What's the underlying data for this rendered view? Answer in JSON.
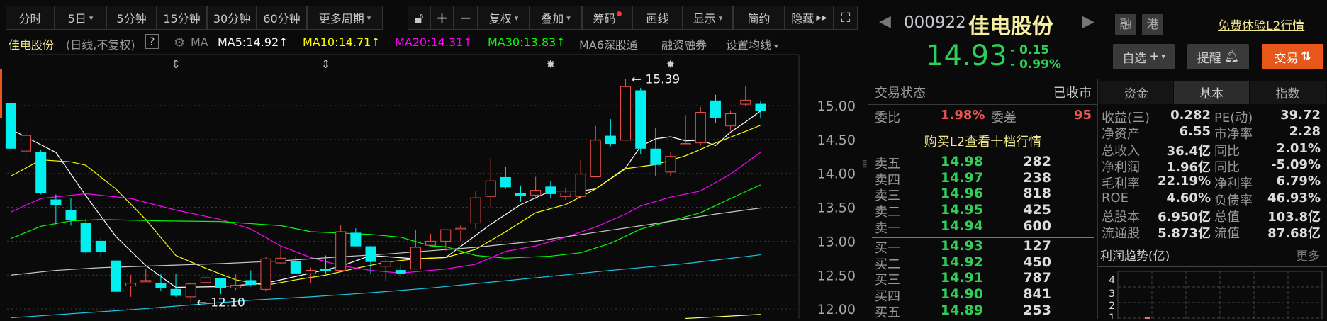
{
  "toolbar": {
    "periods": [
      {
        "label": "分时",
        "dropdown": false
      },
      {
        "label": "5日",
        "dropdown": true
      },
      {
        "label": "5分钟",
        "dropdown": false
      },
      {
        "label": "15分钟",
        "dropdown": false
      },
      {
        "label": "30分钟",
        "dropdown": false
      },
      {
        "label": "60分钟",
        "dropdown": false
      },
      {
        "label": "更多周期",
        "dropdown": true
      }
    ],
    "tools": [
      {
        "label": "复权",
        "dropdown": true
      },
      {
        "label": "叠加",
        "dropdown": true
      },
      {
        "label": "筹码",
        "dropdown": false,
        "badge": true
      },
      {
        "label": "画线",
        "dropdown": false
      },
      {
        "label": "显示",
        "dropdown": true
      },
      {
        "label": "简约",
        "dropdown": false
      },
      {
        "label": "隐藏",
        "dropdown": false
      }
    ],
    "icons": [
      "lock-icon",
      "plus-icon",
      "minus-icon",
      "expand-icon"
    ]
  },
  "legend": {
    "name": "佳电股份",
    "mode": "(日线,不复权)",
    "help": "?",
    "ma": "MA",
    "ma5": "MA5:14.92",
    "ma10": "MA10:14.71",
    "ma20": "MA20:14.31",
    "ma30": "MA30:13.83",
    "ma6": "MA6深股通",
    "margin": "融资融券",
    "settings": "设置均线",
    "arrow": "↑"
  },
  "colors": {
    "up": "#f0524f",
    "down": "#00f0f0",
    "ma5": "#ffffff",
    "ma10": "#ffff00",
    "ma20": "#ff00ff",
    "ma30": "#00ff00",
    "ma60": "#c8c8c8",
    "ma120": "#19c8e8",
    "green": "#2ed158",
    "red": "#f0524f",
    "accent": "#e8571a"
  },
  "chart_data": {
    "type": "candlestick",
    "ylim": [
      11.85,
      15.5
    ],
    "yticks": [
      "15.00",
      "14.50",
      "14.00",
      "13.50",
      "13.00",
      "12.50",
      "12.00"
    ],
    "ytick_values": [
      15,
      14.5,
      14,
      13.5,
      13,
      12.5,
      12
    ],
    "candles_ohlc": [
      [
        15.03,
        15.08,
        14.31,
        14.37
      ],
      [
        14.33,
        14.75,
        14.12,
        14.56
      ],
      [
        14.31,
        14.35,
        13.69,
        13.71
      ],
      [
        13.61,
        13.69,
        13.25,
        13.54
      ],
      [
        13.45,
        13.64,
        13.23,
        13.32
      ],
      [
        13.26,
        13.33,
        12.82,
        12.84
      ],
      [
        13.0,
        13.05,
        12.77,
        12.85
      ],
      [
        12.71,
        12.75,
        12.18,
        12.26
      ],
      [
        12.34,
        12.5,
        12.18,
        12.38
      ],
      [
        12.4,
        12.6,
        12.4,
        12.42
      ],
      [
        12.38,
        12.52,
        12.26,
        12.32
      ],
      [
        12.29,
        12.52,
        12.18,
        12.2
      ],
      [
        12.18,
        12.39,
        12.1,
        12.37
      ],
      [
        12.39,
        12.5,
        12.36,
        12.46
      ],
      [
        12.45,
        12.46,
        12.22,
        12.32
      ],
      [
        12.31,
        12.51,
        12.28,
        12.35
      ],
      [
        12.42,
        12.57,
        12.33,
        12.36
      ],
      [
        12.29,
        12.77,
        12.26,
        12.74
      ],
      [
        12.68,
        12.92,
        12.67,
        12.75
      ],
      [
        12.7,
        12.78,
        12.53,
        12.53
      ],
      [
        12.52,
        12.61,
        12.38,
        12.57
      ],
      [
        12.59,
        12.79,
        12.52,
        12.56
      ],
      [
        12.57,
        13.24,
        12.57,
        13.14
      ],
      [
        13.12,
        13.19,
        12.91,
        12.93
      ],
      [
        12.92,
        12.93,
        12.52,
        12.7
      ],
      [
        12.63,
        12.73,
        12.41,
        12.7
      ],
      [
        12.57,
        12.65,
        12.47,
        12.53
      ],
      [
        12.59,
        13.17,
        12.59,
        12.91
      ],
      [
        12.94,
        13.11,
        12.93,
        13.0
      ],
      [
        13.0,
        13.17,
        12.86,
        13.17
      ],
      [
        13.17,
        13.24,
        13.0,
        13.19
      ],
      [
        13.27,
        13.74,
        13.18,
        13.64
      ],
      [
        13.66,
        14.22,
        13.5,
        13.89
      ],
      [
        13.94,
        14.1,
        13.77,
        13.8
      ],
      [
        13.7,
        13.82,
        13.58,
        13.67
      ],
      [
        13.68,
        13.95,
        13.62,
        13.75
      ],
      [
        13.8,
        13.89,
        13.64,
        13.7
      ],
      [
        13.66,
        13.79,
        13.61,
        13.71
      ],
      [
        13.66,
        14.2,
        13.66,
        13.99
      ],
      [
        13.95,
        14.7,
        13.95,
        14.49
      ],
      [
        14.55,
        14.8,
        14.4,
        14.44
      ],
      [
        14.49,
        15.39,
        14.49,
        15.28
      ],
      [
        15.22,
        15.26,
        14.29,
        14.37
      ],
      [
        14.36,
        14.67,
        13.96,
        14.13
      ],
      [
        14.02,
        14.32,
        13.96,
        14.25
      ],
      [
        14.43,
        14.86,
        14.43,
        14.44
      ],
      [
        14.45,
        14.98,
        14.41,
        14.9
      ],
      [
        15.07,
        15.16,
        14.75,
        14.82
      ],
      [
        14.7,
        14.93,
        14.63,
        14.88
      ],
      [
        15.02,
        15.29,
        15.0,
        15.08
      ],
      [
        15.02,
        15.07,
        14.82,
        14.93
      ]
    ],
    "ma_series": [
      {
        "name": "MA5",
        "color": "#ffffff",
        "points": [
          [
            0,
            14.65
          ],
          [
            3,
            14.31
          ],
          [
            5,
            13.67
          ],
          [
            7,
            13.07
          ],
          [
            9,
            12.64
          ],
          [
            11,
            12.32
          ],
          [
            14,
            12.33
          ],
          [
            17,
            12.38
          ],
          [
            20,
            12.53
          ],
          [
            22,
            12.63
          ],
          [
            24,
            12.79
          ],
          [
            27,
            12.74
          ],
          [
            29,
            12.76
          ],
          [
            32,
            13.25
          ],
          [
            34,
            13.54
          ],
          [
            36,
            13.74
          ],
          [
            38,
            13.74
          ],
          [
            39,
            13.77
          ],
          [
            41,
            14.08
          ],
          [
            42,
            14.4
          ],
          [
            43,
            14.51
          ],
          [
            44,
            14.54
          ],
          [
            45,
            14.48
          ],
          [
            46,
            14.49
          ],
          [
            47,
            14.41
          ],
          [
            48,
            14.61
          ],
          [
            49,
            14.76
          ],
          [
            50,
            14.92
          ]
        ]
      },
      {
        "name": "MA10",
        "color": "#ffff00",
        "points": [
          [
            0,
            13.96
          ],
          [
            2,
            14.2
          ],
          [
            4,
            14.17
          ],
          [
            5,
            14.12
          ],
          [
            7,
            13.77
          ],
          [
            9,
            13.32
          ],
          [
            11,
            12.79
          ],
          [
            13,
            12.6
          ],
          [
            15,
            12.43
          ],
          [
            17,
            12.35
          ],
          [
            19,
            12.43
          ],
          [
            21,
            12.5
          ],
          [
            23,
            12.6
          ],
          [
            25,
            12.69
          ],
          [
            27,
            12.74
          ],
          [
            29,
            12.76
          ],
          [
            31,
            12.88
          ],
          [
            33,
            13.14
          ],
          [
            35,
            13.42
          ],
          [
            37,
            13.54
          ],
          [
            39,
            13.77
          ],
          [
            41,
            14.07
          ],
          [
            43,
            14.13
          ],
          [
            45,
            14.26
          ],
          [
            47,
            14.45
          ],
          [
            49,
            14.62
          ],
          [
            50,
            14.71
          ]
        ]
      },
      {
        "name": "MA20",
        "color": "#ff00ff",
        "points": [
          [
            0,
            13.43
          ],
          [
            2,
            13.63
          ],
          [
            5,
            13.7
          ],
          [
            8,
            13.63
          ],
          [
            11,
            13.46
          ],
          [
            14,
            13.32
          ],
          [
            16,
            13.18
          ],
          [
            18,
            12.93
          ],
          [
            20,
            12.76
          ],
          [
            22,
            12.64
          ],
          [
            24,
            12.57
          ],
          [
            26,
            12.53
          ],
          [
            28,
            12.57
          ],
          [
            29,
            12.59
          ],
          [
            31,
            12.66
          ],
          [
            33,
            12.85
          ],
          [
            35,
            12.93
          ],
          [
            37,
            13.06
          ],
          [
            39,
            13.21
          ],
          [
            41,
            13.4
          ],
          [
            42,
            13.52
          ],
          [
            44,
            13.65
          ],
          [
            46,
            13.74
          ],
          [
            48,
            13.99
          ],
          [
            50,
            14.31
          ]
        ]
      },
      {
        "name": "MA30",
        "color": "#00ff00",
        "points": [
          [
            0,
            13.04
          ],
          [
            2,
            13.22
          ],
          [
            4,
            13.3
          ],
          [
            6,
            13.32
          ],
          [
            10,
            13.3
          ],
          [
            14,
            13.29
          ],
          [
            18,
            13.23
          ],
          [
            20,
            13.14
          ],
          [
            24,
            13.1
          ],
          [
            26,
            13.06
          ],
          [
            28,
            12.93
          ],
          [
            29,
            12.92
          ],
          [
            31,
            12.79
          ],
          [
            33,
            12.75
          ],
          [
            36,
            12.78
          ],
          [
            38,
            12.83
          ],
          [
            40,
            12.97
          ],
          [
            42,
            13.18
          ],
          [
            44,
            13.3
          ],
          [
            46,
            13.42
          ],
          [
            48,
            13.63
          ],
          [
            50,
            13.83
          ]
        ]
      },
      {
        "name": "MA60",
        "color": "#c8c8c8",
        "points": [
          [
            0,
            12.5
          ],
          [
            3,
            12.57
          ],
          [
            6,
            12.61
          ],
          [
            10,
            12.64
          ],
          [
            14,
            12.67
          ],
          [
            18,
            12.71
          ],
          [
            22,
            12.77
          ],
          [
            25,
            12.81
          ],
          [
            28,
            12.86
          ],
          [
            31,
            12.91
          ],
          [
            35,
            13.0
          ],
          [
            39,
            13.13
          ],
          [
            43,
            13.26
          ],
          [
            47,
            13.4
          ],
          [
            50,
            13.49
          ]
        ]
      },
      {
        "name": "MA120",
        "color": "#19c8e8",
        "points": [
          [
            0,
            11.87
          ],
          [
            8,
            11.99
          ],
          [
            12,
            12.06
          ],
          [
            16,
            12.13
          ],
          [
            20,
            12.18
          ],
          [
            24,
            12.24
          ],
          [
            28,
            12.31
          ],
          [
            35,
            12.46
          ],
          [
            40,
            12.57
          ],
          [
            45,
            12.67
          ],
          [
            50,
            12.8
          ]
        ]
      },
      {
        "name": "MA250",
        "color": "#ffff66",
        "points": [
          [
            45,
            11.86
          ],
          [
            50,
            11.92
          ]
        ]
      }
    ],
    "annotations": [
      {
        "index": 41,
        "price": 15.39,
        "label": "15.39"
      },
      {
        "index": 12,
        "price": 12.1,
        "label": "12.10"
      }
    ],
    "event_markers": [
      {
        "index": 11,
        "icon": "updown-arrow-icon"
      },
      {
        "index": 21,
        "icon": "updown-arrow-icon"
      },
      {
        "index": 36,
        "icon": "star-icon"
      },
      {
        "index": 44,
        "icon": "star-icon"
      }
    ]
  },
  "quote": {
    "code": "000922",
    "name": "佳电股份",
    "tag_margin": "融",
    "tag_hk": "港",
    "l2_link": "免费体验L2行情",
    "price": "14.93",
    "change": "- 0.15",
    "change_pct": "- 0.99%",
    "watch_btn": "自选",
    "alert_btn": "提醒",
    "trade_btn": "交易"
  },
  "orderbook": {
    "status_label": "交易状态",
    "status_value": "已收市",
    "ratio_label": "委比",
    "ratio_value": "1.98%",
    "diff_label": "委差",
    "diff_value": "95",
    "buy_l2": "购买L2查看十档行情",
    "asks": [
      {
        "label": "卖五",
        "price": "14.98",
        "vol": "282"
      },
      {
        "label": "卖四",
        "price": "14.97",
        "vol": "238"
      },
      {
        "label": "卖三",
        "price": "14.96",
        "vol": "818"
      },
      {
        "label": "卖二",
        "price": "14.95",
        "vol": "425"
      },
      {
        "label": "卖一",
        "price": "14.94",
        "vol": "600"
      }
    ],
    "bids": [
      {
        "label": "买一",
        "price": "14.93",
        "vol": "127"
      },
      {
        "label": "买二",
        "price": "14.92",
        "vol": "450"
      },
      {
        "label": "买三",
        "price": "14.91",
        "vol": "787"
      },
      {
        "label": "买四",
        "price": "14.90",
        "vol": "841"
      },
      {
        "label": "买五",
        "price": "14.89",
        "vol": "253"
      }
    ]
  },
  "fundamentals": {
    "tabs": [
      "资金",
      "基本",
      "指数"
    ],
    "rows": [
      [
        "收益(三)",
        "0.282",
        "PE(动)",
        "39.72"
      ],
      [
        "净资产",
        "6.55",
        "市净率",
        "2.28"
      ],
      [
        "总收入",
        "36.4亿",
        "同比",
        "2.01%"
      ],
      [
        "净利润",
        "1.96亿",
        "同比",
        "-5.09%"
      ],
      [
        "毛利率",
        "22.19%",
        "净利率",
        "6.79%"
      ],
      [
        "ROE",
        "4.60%",
        "负债率",
        "46.93%"
      ],
      [
        "总股本",
        "6.950亿",
        "总值",
        "103.8亿"
      ],
      [
        "流通股",
        "5.873亿",
        "流值",
        "87.68亿"
      ]
    ],
    "profit_title": "利润趋势(亿)",
    "more": "更多",
    "profit_yticks": [
      "4",
      "3",
      "2",
      "1"
    ]
  }
}
